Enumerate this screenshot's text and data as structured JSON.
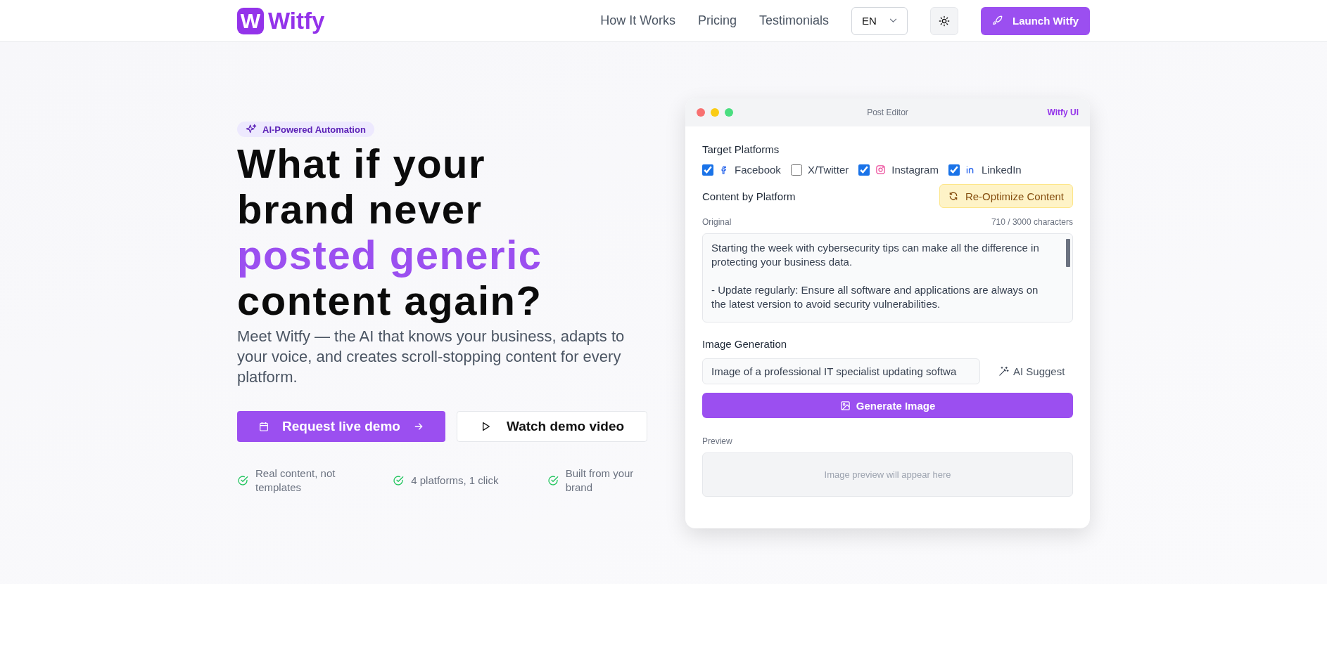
{
  "header": {
    "logo": {
      "mark": "W",
      "name": "Witfy"
    },
    "nav": [
      "How It Works",
      "Pricing",
      "Testimonials"
    ],
    "language": {
      "value": "EN"
    },
    "cta": "Launch Witfy"
  },
  "hero": {
    "badge": "AI-Powered Automation",
    "headline": [
      {
        "text": "What if your",
        "accent": false
      },
      {
        "text": "brand never",
        "accent": false
      },
      {
        "text": "posted generic",
        "accent": true
      },
      {
        "text": "content again?",
        "accent": false
      }
    ],
    "subtitle": "Meet Witfy — the AI that knows your business, adapts to your voice, and creates scroll-stopping content for every platform.",
    "buttons": [
      {
        "label": "Request live demo",
        "kind": "primary"
      },
      {
        "label": "Watch demo video",
        "kind": "secondary"
      }
    ],
    "features": [
      "Real content, not templates",
      "4 platforms, 1 click",
      "Built from your brand"
    ]
  },
  "editor": {
    "title": "Post Editor",
    "brand": "Witfy UI",
    "platforms_label": "Target Platforms",
    "platforms": [
      {
        "name": "Facebook",
        "kind": "facebook",
        "checked": true
      },
      {
        "name": "X/Twitter",
        "kind": "x",
        "checked": false
      },
      {
        "name": "Instagram",
        "kind": "instagram",
        "checked": true
      },
      {
        "name": "LinkedIn",
        "kind": "linkedin",
        "checked": true
      }
    ],
    "content_label": "Content by Platform",
    "reoptimize": "Re-Optimize Content",
    "original_label": "Original",
    "char_count": "710 / 3000 characters",
    "original_text": "Starting the week with cybersecurity tips can make all the difference in protecting your business data.\n\n- Update regularly: Ensure all software and applications are always on the latest version to avoid security vulnerabilities.",
    "image_label": "Image Generation",
    "image_prompt": "Image of a professional IT specialist updating softwa",
    "ai_suggest": "AI Suggest",
    "generate": "Generate Image",
    "preview_label": "Preview",
    "preview_placeholder": "Image preview will appear here"
  }
}
